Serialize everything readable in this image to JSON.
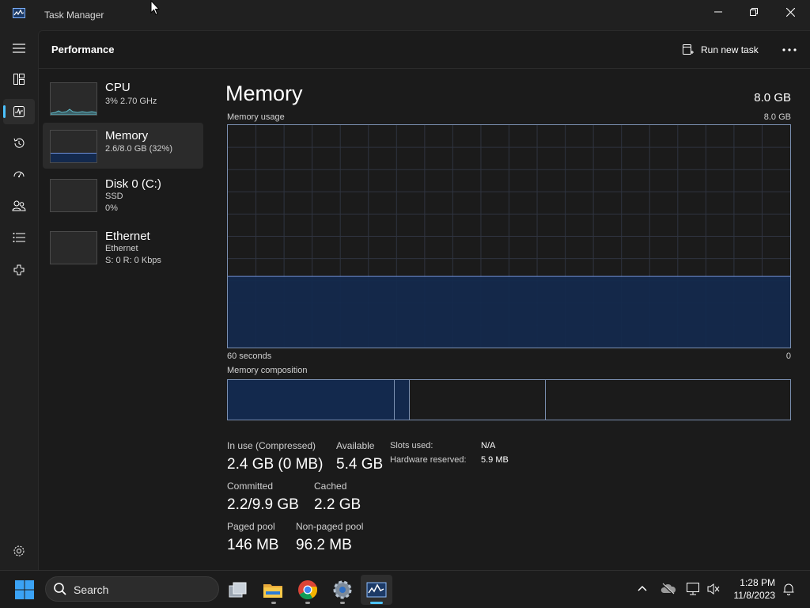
{
  "window": {
    "title": "Task Manager",
    "page_title": "Performance",
    "run_new_task_label": "Run new task",
    "more_label": "⋯"
  },
  "nav": {
    "items": [
      {
        "icon": "hamburger-menu-icon"
      },
      {
        "icon": "processes-icon"
      },
      {
        "icon": "performance-icon",
        "active": true
      },
      {
        "icon": "app-history-icon"
      },
      {
        "icon": "startup-apps-icon"
      },
      {
        "icon": "users-icon"
      },
      {
        "icon": "details-icon"
      },
      {
        "icon": "services-icon"
      },
      {
        "icon": "settings-icon"
      }
    ]
  },
  "resources": [
    {
      "name": "CPU",
      "line1": "3%  2.70 GHz",
      "line2": ""
    },
    {
      "name": "Memory",
      "line1": "2.6/8.0 GB (32%)",
      "line2": "",
      "selected": true
    },
    {
      "name": "Disk 0 (C:)",
      "line1": "SSD",
      "line2": "0%"
    },
    {
      "name": "Ethernet",
      "line1": "Ethernet",
      "line2": "S: 0  R: 0 Kbps"
    }
  ],
  "detail": {
    "title": "Memory",
    "total": "8.0 GB",
    "usage_label": "Memory usage",
    "usage_max": "8.0 GB",
    "time_left": "60 seconds",
    "time_right": "0",
    "usage_fraction": 0.32,
    "composition_label": "Memory composition",
    "composition": {
      "in_use_fraction": 0.297,
      "modified_fraction": 0.026,
      "standby_fraction": 0.243
    },
    "stats": {
      "in_use_label": "In use (Compressed)",
      "in_use_value": "2.4 GB (0 MB)",
      "available_label": "Available",
      "available_value": "5.4 GB",
      "committed_label": "Committed",
      "committed_value": "2.2/9.9 GB",
      "cached_label": "Cached",
      "cached_value": "2.2 GB",
      "paged_label": "Paged pool",
      "paged_value": "146 MB",
      "nonpaged_label": "Non-paged pool",
      "nonpaged_value": "96.2 MB"
    },
    "kv": {
      "slots_label": "Slots used:",
      "slots_value": "N/A",
      "reserved_label": "Hardware reserved:",
      "reserved_value": "5.9 MB"
    }
  },
  "taskbar": {
    "search_text": "Search",
    "time": "1:28 PM",
    "date": "11/8/2023",
    "apps": [
      "task-view-icon",
      "file-explorer-icon",
      "chrome-icon",
      "settings-app-icon",
      "task-manager-icon"
    ],
    "tray": [
      "chevron-up-icon",
      "onedrive-icon",
      "network-icon",
      "volume-muted-icon",
      "notification-bell-icon"
    ]
  },
  "colors": {
    "accent": "#4cc2ff",
    "memory_line": "#6f8fd6",
    "memory_fill": "#13294d"
  }
}
